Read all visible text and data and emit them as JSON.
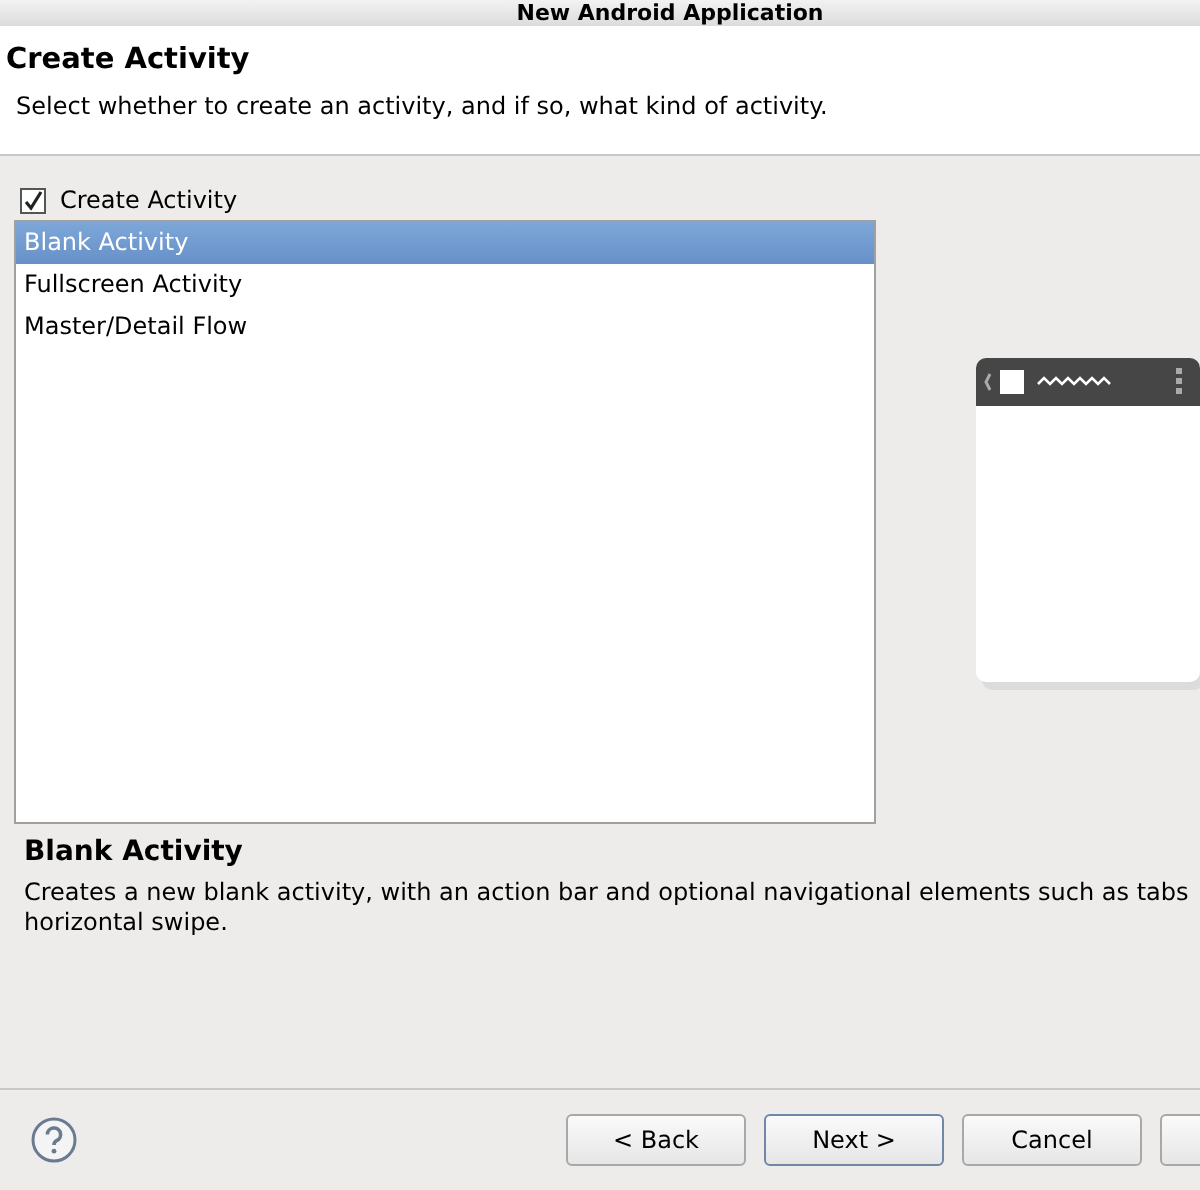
{
  "window": {
    "title": "New Android Application"
  },
  "header": {
    "title": "Create Activity",
    "subtitle": "Select whether to create an activity, and if so, what kind of activity."
  },
  "create_activity": {
    "label": "Create Activity",
    "checked": true
  },
  "templates": [
    {
      "label": "Blank Activity",
      "selected": true
    },
    {
      "label": "Fullscreen Activity",
      "selected": false
    },
    {
      "label": "Master/Detail Flow",
      "selected": false
    }
  ],
  "description": {
    "title": "Blank Activity",
    "lines": [
      "Creates a new blank activity, with an action bar and optional navigational elements such as tabs",
      "horizontal swipe."
    ]
  },
  "buttons": [
    {
      "label": "< Back",
      "focused": false
    },
    {
      "label": "Next >",
      "focused": true
    },
    {
      "label": "Cancel",
      "focused": false
    },
    {
      "focused": false
    }
  ]
}
